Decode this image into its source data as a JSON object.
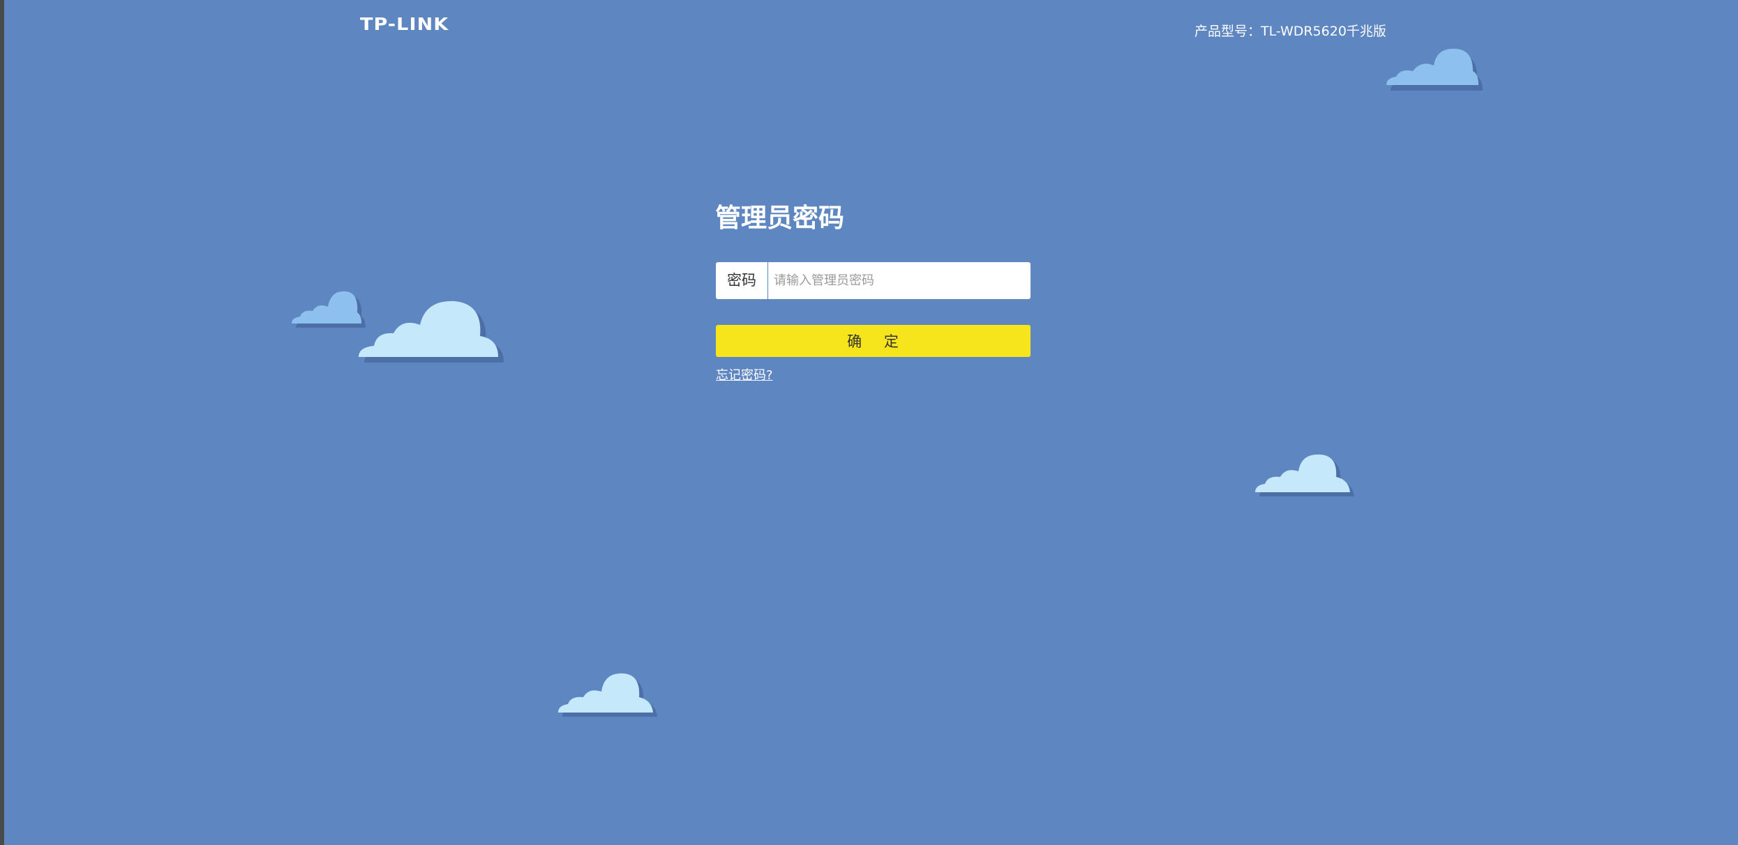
{
  "header": {
    "logo_text": "TP-LINK",
    "model_label": "产品型号：TL-WDR5620千兆版"
  },
  "login": {
    "title": "管理员密码",
    "password_label": "密码",
    "password_placeholder": "请输入管理员密码",
    "password_value": "",
    "confirm_label": "确    定",
    "forgot_link": "忘记密码?"
  },
  "colors": {
    "background": "#5e86c1",
    "button": "#f7e51b",
    "cloud_light": "#c5e8fb",
    "cloud_blue": "#8ec0ee",
    "cloud_shadow": "#4d6fa8"
  },
  "decorations": {
    "clouds": [
      "cloud-icon",
      "cloud-icon",
      "cloud-icon",
      "cloud-icon",
      "cloud-icon",
      "cloud-icon"
    ]
  }
}
